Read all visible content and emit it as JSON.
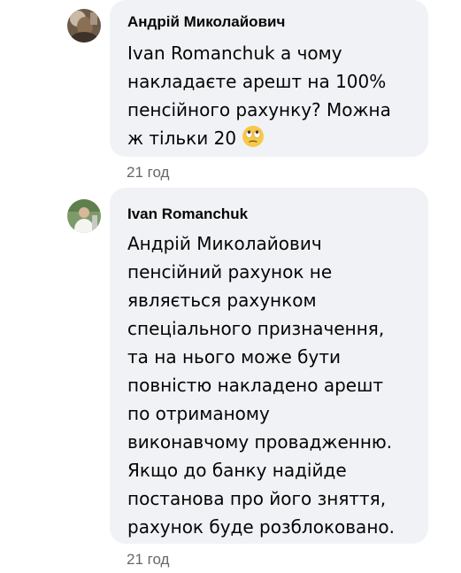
{
  "comments": [
    {
      "author": "Андрій Миколайович",
      "lines": [
        "Ivan Romanchuk а чому",
        "накладаєте арешт на 100%",
        "пенсійного рахунку? Можна",
        "ж тільки 20"
      ],
      "emoji": "face-with-rolling-eyes-icon",
      "time": "21 год"
    },
    {
      "author": "Ivan Romanchuk",
      "lines": [
        "Андрій Миколайович",
        "пенсійний рахунок не",
        "являється рахунком",
        "спеціального призначення,",
        "та на нього може бути",
        "повністю накладено арешт",
        "по отриманому",
        "виконавчому провадженню.",
        "Якщо до банку надійде",
        "постанова про його зняття,",
        "рахунок буде розблоковано."
      ],
      "time": "21 год"
    }
  ],
  "colors": {
    "bubble": "#f0f2f5",
    "text": "#050505",
    "meta": "#65676b"
  }
}
